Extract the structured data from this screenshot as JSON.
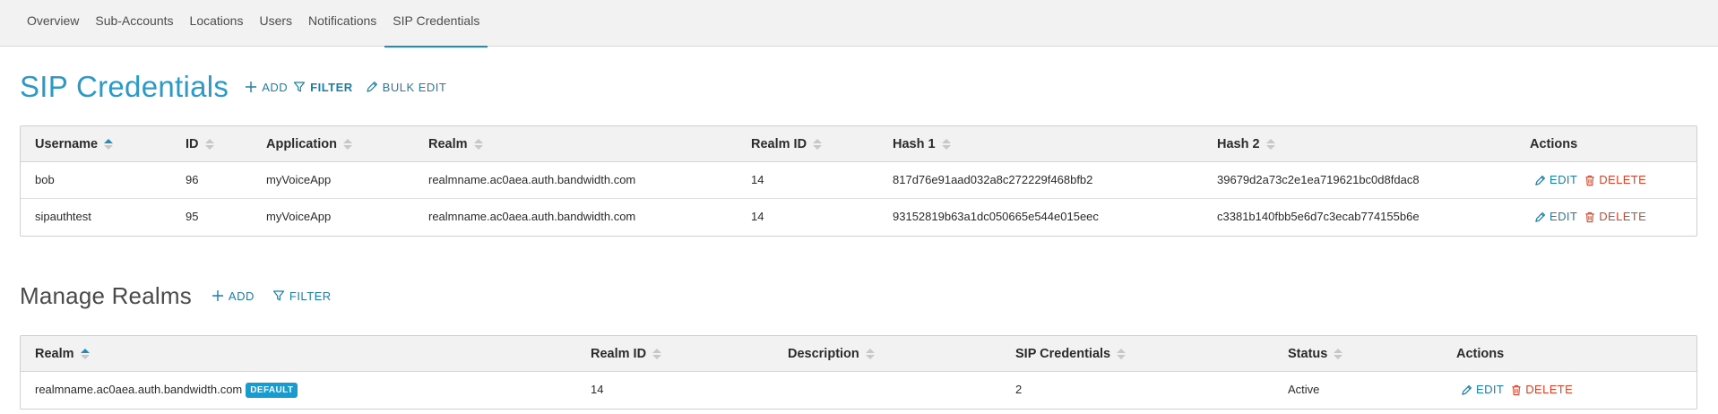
{
  "nav": {
    "tabs": [
      {
        "label": "Overview"
      },
      {
        "label": "Sub-Accounts"
      },
      {
        "label": "Locations"
      },
      {
        "label": "Users"
      },
      {
        "label": "Notifications"
      },
      {
        "label": "SIP Credentials",
        "active": true
      }
    ]
  },
  "sip": {
    "title": "SIP Credentials",
    "add_label": "ADD",
    "filter_label": "FILTER",
    "bulk_edit_label": "BULK EDIT",
    "columns": [
      "Username",
      "ID",
      "Application",
      "Realm",
      "Realm ID",
      "Hash 1",
      "Hash 2",
      "Actions"
    ],
    "sorted_column": "Username",
    "rows": [
      {
        "username": "bob",
        "id": "96",
        "application": "myVoiceApp",
        "realm": "realmname.ac0aea.auth.bandwidth.com",
        "realm_id": "14",
        "hash1": "817d76e91aad032a8c272229f468bfb2",
        "hash2": "39679d2a73c2e1ea719621bc0d8fdac8",
        "edit_label": "EDIT",
        "delete_label": "DELETE"
      },
      {
        "username": "sipauthtest",
        "id": "95",
        "application": "myVoiceApp",
        "realm": "realmname.ac0aea.auth.bandwidth.com",
        "realm_id": "14",
        "hash1": "93152819b63a1dc050665e544e015eec",
        "hash2": "c3381b140fbb5e6d7c3ecab774155b6e",
        "edit_label": "EDIT",
        "delete_label": "DELETE"
      }
    ]
  },
  "realms": {
    "title": "Manage Realms",
    "add_label": "ADD",
    "filter_label": "FILTER",
    "columns": [
      "Realm",
      "Realm ID",
      "Description",
      "SIP Credentials",
      "Status",
      "Actions"
    ],
    "sorted_column": "Realm",
    "rows": [
      {
        "realm": "realmname.ac0aea.auth.bandwidth.com",
        "badge": "DEFAULT",
        "realm_id": "14",
        "description": "",
        "sip_credentials": "2",
        "status": "Active",
        "edit_label": "EDIT",
        "delete_label": "DELETE"
      }
    ]
  },
  "colors": {
    "accent": "#1a8fc0",
    "link": "#1a7fa8",
    "danger": "#d9442a",
    "badge": "#1a9bd0",
    "header_bg": "#f2f2f2"
  },
  "icons": {
    "add": "plus-icon",
    "filter": "filter-icon",
    "edit": "pencil-icon",
    "delete": "trash-icon",
    "sort": "sort-icon"
  }
}
